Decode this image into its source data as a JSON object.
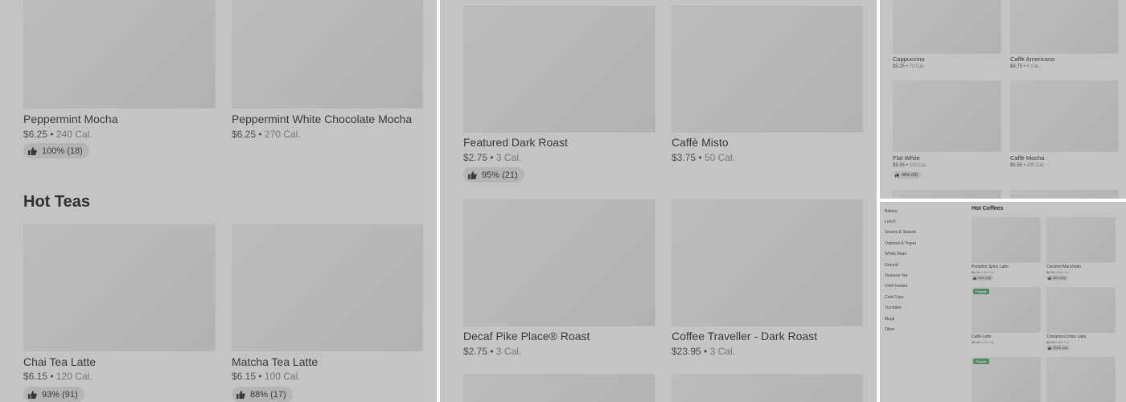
{
  "panel1": {
    "cards": [
      {
        "name": "Peppermint Mocha",
        "price": "$6.25",
        "cal": "240 Cal.",
        "rating": "100% (18)"
      },
      {
        "name": "Peppermint White Chocolate Mocha",
        "price": "$6.25",
        "cal": "270 Cal."
      },
      {
        "name": "Chai Tea Latte",
        "price": "$6.15",
        "cal": "120 Cal.",
        "rating": "93% (91)"
      },
      {
        "name": "Matcha Tea Latte",
        "price": "$6.15",
        "cal": "100 Cal.",
        "rating": "88% (17)"
      }
    ],
    "section_title": "Hot Teas"
  },
  "panel2": {
    "cards": [
      {
        "name": "Featured Dark Roast",
        "price": "$2.75",
        "cal": "3 Cal.",
        "rating": "95% (21)"
      },
      {
        "name": "Caffè Misto",
        "price": "$3.75",
        "cal": "50 Cal."
      },
      {
        "name": "Decaf Pike Place® Roast",
        "price": "$2.75",
        "cal": "3 Cal."
      },
      {
        "name": "Coffee Traveller - Dark Roast",
        "price": "$23.95",
        "cal": "3 Cal."
      }
    ]
  },
  "panel3": {
    "cards": [
      {
        "name": "Cappuccino",
        "price": "$5.25",
        "cal": "70 Cal."
      },
      {
        "name": "Caffè Americano",
        "price": "$4.75",
        "cal": "4 Cal."
      },
      {
        "name": "Flat White",
        "price": "$5.95",
        "cal": "110 Cal.",
        "rating": "94% (18)"
      },
      {
        "name": "Caffè Mocha",
        "price": "$5.95",
        "cal": "200 Cal."
      }
    ]
  },
  "panel4": {
    "sidebar": [
      "Bakery",
      "Lunch",
      "Snacks & Sweets",
      "Oatmeal & Yogurt",
      "Whole Bean",
      "Ground",
      "Teavana Tea",
      "VIA® Instant",
      "Cold Cups",
      "Tumblers",
      "Mugs",
      "Other"
    ],
    "section_title": "Hot Coffees",
    "popular_label": "Popular",
    "cards": [
      {
        "name": "Pumpkin Spice Latte",
        "price": "$6.25",
        "cal": "300 Cal.",
        "rating": "94% (36)"
      },
      {
        "name": "Caramel Macchiato",
        "price": "$5.95",
        "cal": "190 Cal.",
        "rating": "98% (50)"
      },
      {
        "name": "Caffè Latte",
        "price": "$5.25",
        "cal": "150 Cal."
      },
      {
        "name": "Cinnamon Dolce Latte",
        "price": "$6.25",
        "cal": "180 Cal.",
        "rating": "100% (46)"
      }
    ]
  },
  "separator": "•",
  "icons": {
    "rating": "thumbs-up-icon"
  },
  "colors": {
    "overlay": "#c4c4c4",
    "popular_badge": "#4f8a63"
  }
}
